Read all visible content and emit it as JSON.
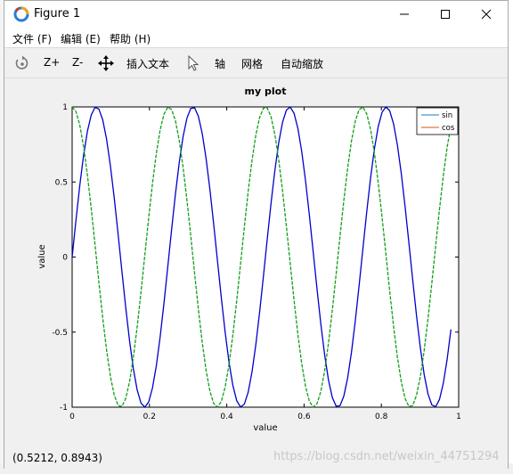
{
  "window": {
    "title": "Figure 1",
    "controls": {
      "minimize": "—",
      "maximize": "☐",
      "close": "✕"
    }
  },
  "menu": [
    {
      "label": "文件 (F)"
    },
    {
      "label": "编辑 (E)"
    },
    {
      "label": "帮助 (H)"
    }
  ],
  "toolbar": {
    "rotate_icon": "rotate-icon",
    "zoom_in_label": "Z+",
    "zoom_out_label": "Z-",
    "pan_icon": "pan-icon",
    "insert_text_label": "插入文本",
    "select_icon": "pointer-icon",
    "axis_label": "轴",
    "grid_label": "网格",
    "autoscale_label": "自动缩放"
  },
  "status": {
    "coords": "(0.5212, 0.8943)"
  },
  "watermark": "https://blog.csdn.net/weixin_44751294",
  "chart_data": {
    "type": "line",
    "title": "my plot",
    "xlabel": "value",
    "ylabel": "value",
    "xlim": [
      0,
      1
    ],
    "ylim": [
      -1,
      1
    ],
    "x_ticks": [
      "0",
      "0.2",
      "0.4",
      "0.6",
      "0.8",
      "1"
    ],
    "y_ticks": [
      "1",
      "0.5",
      "0",
      "-0.5",
      "-1"
    ],
    "grid": false,
    "legend_position": "top-right",
    "sample_count": 100,
    "frequency_cycles_per_unit": 4,
    "series": [
      {
        "name": "sin",
        "function": "sin(2*pi*4*x)",
        "x_start": 0,
        "x_end": 0.98,
        "legend_color": "#1f77b4",
        "line_color": "#0000cc",
        "line_style": "solid"
      },
      {
        "name": "cos",
        "function": "cos(2*pi*4*x)",
        "x_start": 0,
        "x_end": 0.98,
        "legend_color": "#d95319",
        "line_color": "#109e1a",
        "line_style": "dashed"
      }
    ],
    "colors": {
      "axes_bg": "#ffffff",
      "axes_border": "#000000"
    }
  }
}
